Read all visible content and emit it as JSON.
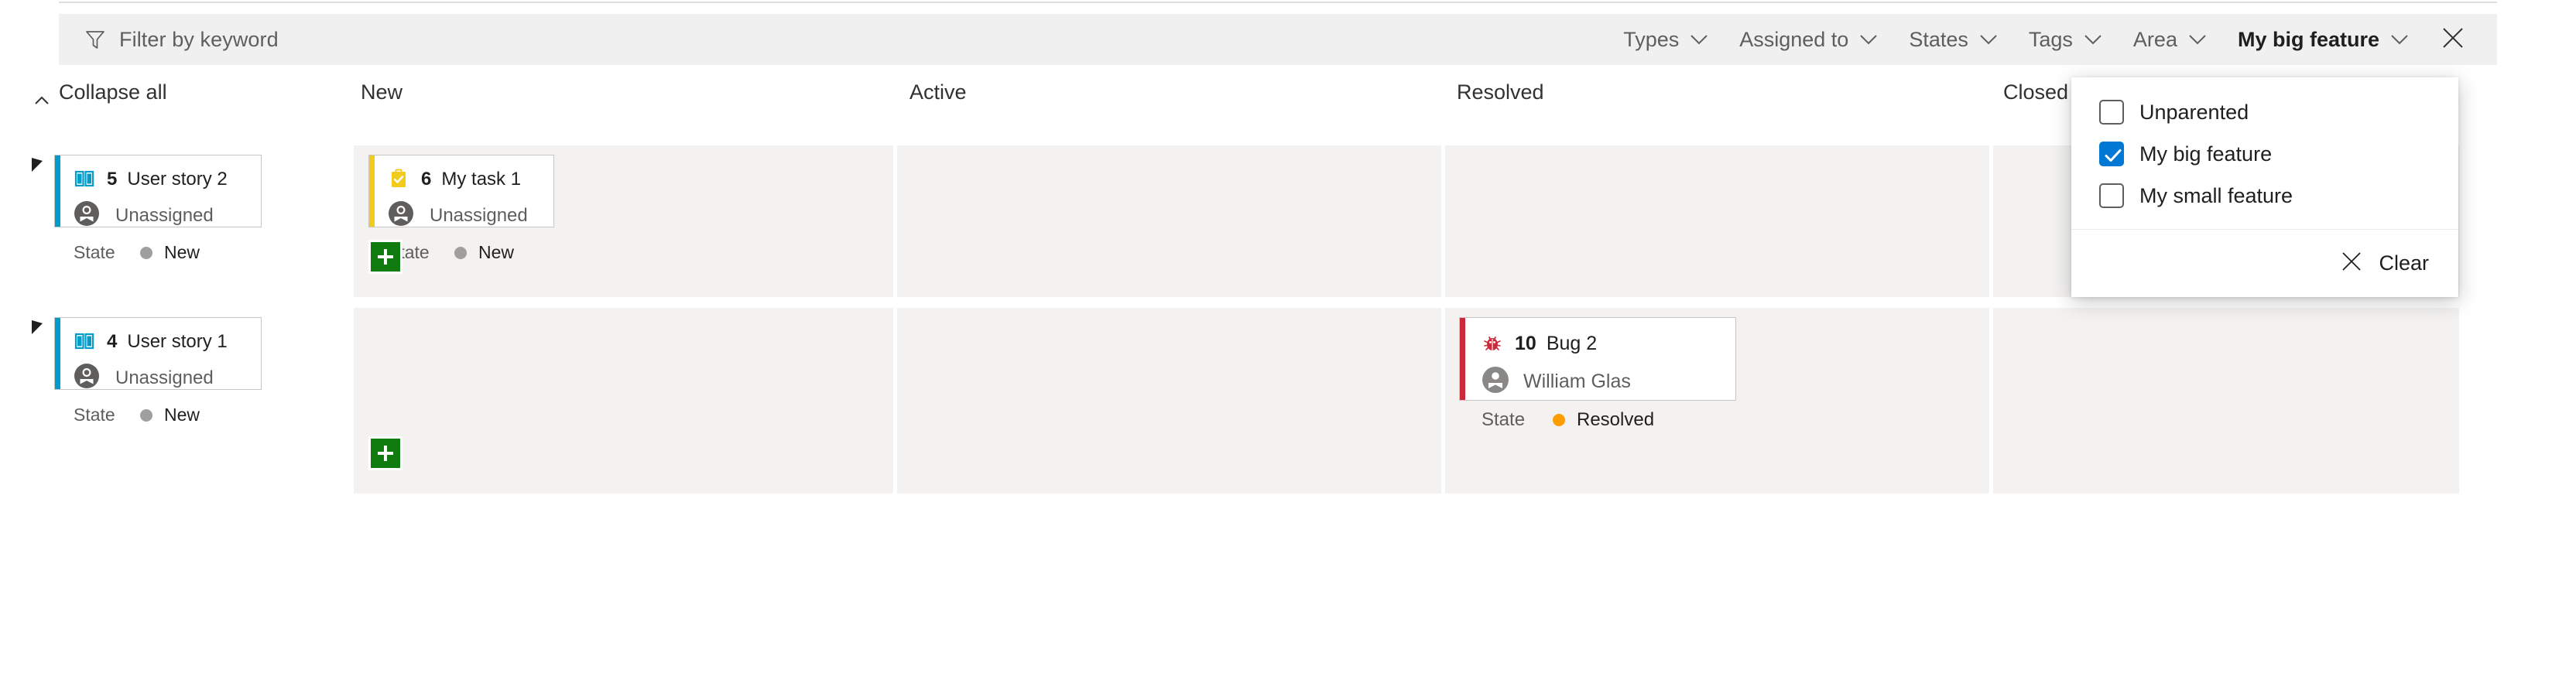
{
  "filter_bar": {
    "keyword": {
      "icon": "funnel-icon",
      "value": "",
      "placeholder": "Filter by keyword"
    },
    "pills": [
      {
        "label": "Types",
        "selected": false,
        "icon": "chevron-down-icon"
      },
      {
        "label": "Assigned to",
        "selected": false,
        "icon": "chevron-down-icon"
      },
      {
        "label": "States",
        "selected": false,
        "icon": "chevron-down-icon"
      },
      {
        "label": "Tags",
        "selected": false,
        "icon": "chevron-down-icon"
      },
      {
        "label": "Area",
        "selected": false,
        "icon": "chevron-down-icon"
      },
      {
        "label": "My big feature",
        "selected": true,
        "icon": "chevron-down-icon"
      }
    ],
    "close_icon": "close-icon"
  },
  "dropdown": {
    "open_for_pill": "My big feature",
    "options": [
      {
        "label": "Unparented",
        "checked": false
      },
      {
        "label": "My big feature",
        "checked": true
      },
      {
        "label": "My small feature",
        "checked": false
      }
    ],
    "clear_label": "Clear",
    "clear_icon": "close-icon",
    "accent_color": "#0078d4"
  },
  "board": {
    "collapse_all_label": "Collapse all",
    "collapse_all_icon": "chevron-up-icon",
    "columns": [
      {
        "label": "New"
      },
      {
        "label": "Active"
      },
      {
        "label": "Resolved"
      },
      {
        "label": "Closed"
      }
    ],
    "lanes": [
      {
        "parent": {
          "id": "5",
          "title": "User story 2",
          "type_icon": "user-story-icon",
          "accent_color": "#009ccc",
          "assignee": "Unassigned",
          "avatar_icon": "unassigned-avatar-icon",
          "state_label": "State",
          "state_value": "New",
          "state_color": "#a19f9d"
        },
        "cells": [
          {
            "column": "New",
            "cards": [
              {
                "id": "6",
                "title": "My task 1",
                "type_icon": "task-icon",
                "accent_color": "#f2cb1d",
                "assignee": "Unassigned",
                "avatar_icon": "unassigned-avatar-icon",
                "state_label": "State",
                "state_value": "New",
                "state_color": "#a19f9d"
              }
            ],
            "add_button": {
              "icon": "plus-icon",
              "color": "#107c10"
            }
          },
          {
            "column": "Active",
            "cards": []
          },
          {
            "column": "Resolved",
            "cards": []
          },
          {
            "column": "Closed",
            "cards": []
          }
        ]
      },
      {
        "parent": {
          "id": "4",
          "title": "User story 1",
          "type_icon": "user-story-icon",
          "accent_color": "#009ccc",
          "assignee": "Unassigned",
          "avatar_icon": "unassigned-avatar-icon",
          "state_label": "State",
          "state_value": "New",
          "state_color": "#a19f9d"
        },
        "cells": [
          {
            "column": "New",
            "cards": [],
            "add_button": {
              "icon": "plus-icon",
              "color": "#107c10"
            }
          },
          {
            "column": "Active",
            "cards": []
          },
          {
            "column": "Resolved",
            "cards": [
              {
                "id": "10",
                "title": "Bug 2",
                "type_icon": "bug-icon",
                "accent_color": "#cc293d",
                "assignee": "William Glas",
                "avatar_icon": "person-avatar-icon",
                "state_label": "State",
                "state_value": "Resolved",
                "state_color": "#ff9d00"
              }
            ]
          },
          {
            "column": "Closed",
            "cards": []
          }
        ]
      }
    ]
  }
}
